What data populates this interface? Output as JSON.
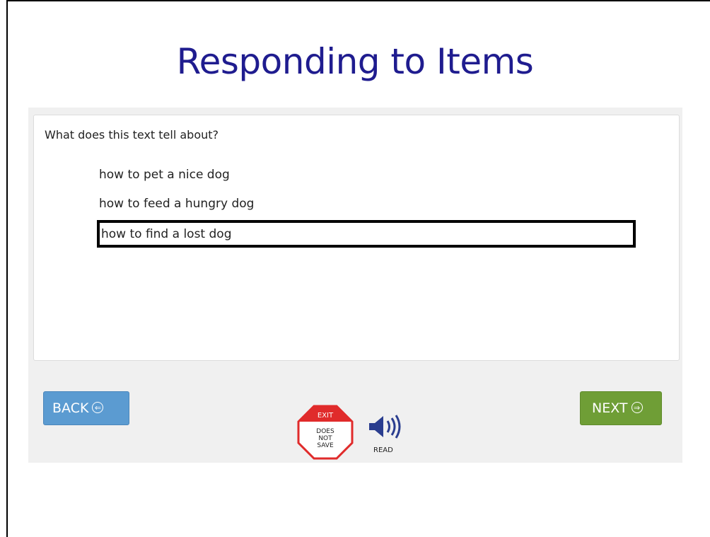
{
  "slide": {
    "title": "Responding to Items"
  },
  "item": {
    "prompt": "What does this text tell about?",
    "options": [
      "how to pet a nice dog",
      "how to feed a hungry dog",
      "how to find a lost dog"
    ],
    "selected_index": 2
  },
  "toolbar": {
    "back_label": "BACK",
    "next_label": "NEXT",
    "exit_label": "EXIT",
    "exit_note_line1": "DOES",
    "exit_note_line2": "NOT",
    "exit_note_line3": "SAVE",
    "read_label": "READ"
  },
  "colors": {
    "title": "#1f1c8f",
    "back_button": "#5b9bd1",
    "next_button": "#6f9e36",
    "exit_red": "#e02b2b",
    "speaker_blue": "#2a3d8f"
  },
  "icons": {
    "back": "circle-left-arrow-icon",
    "next": "circle-right-arrow-icon",
    "exit": "stop-sign-icon",
    "read": "speaker-icon"
  }
}
